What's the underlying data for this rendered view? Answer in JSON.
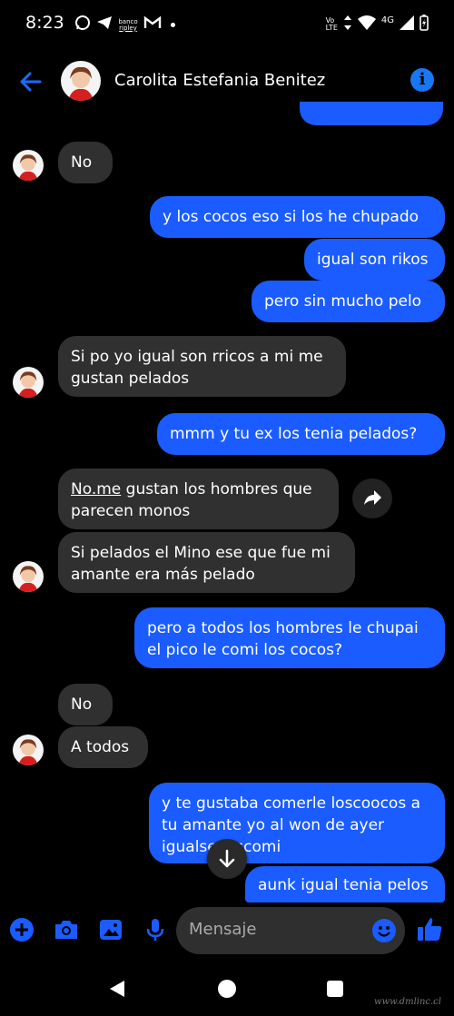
{
  "status_bar": {
    "time": "8:23",
    "ripley_top": "banco",
    "ripley_bottom": "ripley",
    "volte_top": "Vo",
    "volte_bottom": "LTE",
    "network": "4G"
  },
  "header": {
    "contact_name": "Carolita Estefania Benitez"
  },
  "messages": [
    {
      "text": "No"
    },
    {
      "text": "y los cocos eso si los he chupado"
    },
    {
      "text": "igual son rikos"
    },
    {
      "text": "pero sin mucho pelo"
    },
    {
      "text": "Si po yo igual son rricos a mi me gustan pelados"
    },
    {
      "text": "mmm y tu ex los tenia pelados?"
    },
    {
      "link": "No.me",
      "rest": " gustan los hombres que parecen monos"
    },
    {
      "text": "Si pelados el Mino ese que fue mi amante era más pelado"
    },
    {
      "text": "pero a todos los hombres le chupai el pico le comi los cocos?"
    },
    {
      "text": "No"
    },
    {
      "text": "A todos"
    },
    {
      "text": "y te gustaba comerle loscoocos a tu amante yo al won de ayer igualse loscomi"
    },
    {
      "text": "aunk igual tenia pelos"
    }
  ],
  "composer": {
    "placeholder": "Mensaje"
  },
  "watermark": "www.dmlinc.cl",
  "colors": {
    "accent": "#1a5cff",
    "incoming_bubble": "#303030",
    "background": "#000000"
  }
}
